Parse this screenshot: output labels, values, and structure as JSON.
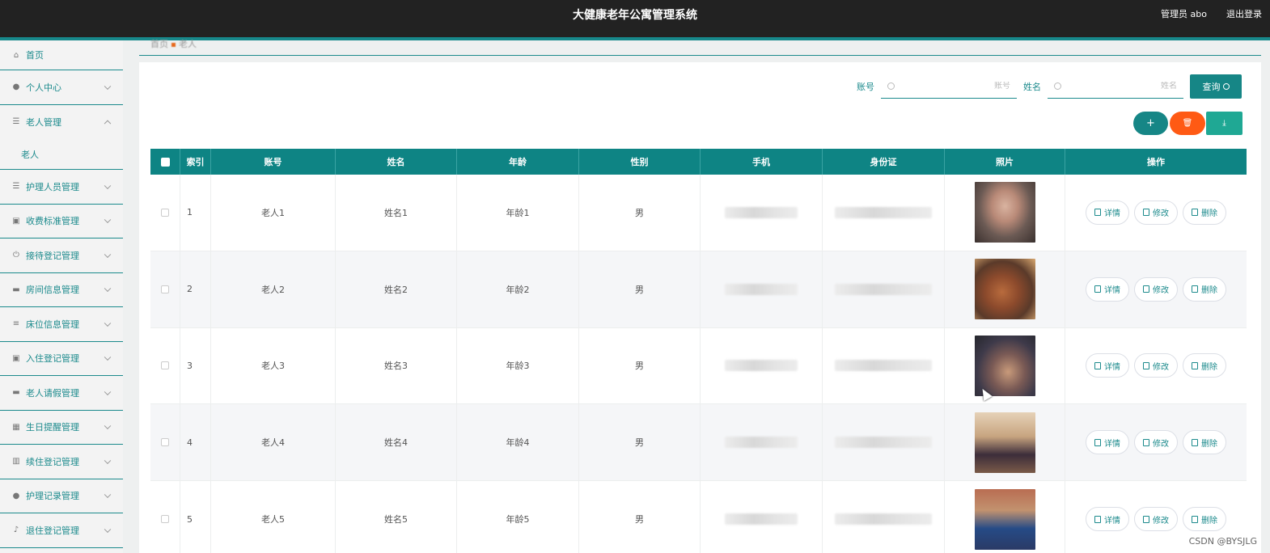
{
  "header": {
    "title": "大健康老年公寓管理系统",
    "user": "管理员 abo",
    "logout": "退出登录"
  },
  "sidebar": {
    "items": [
      {
        "label": "首页",
        "icon": "home-icon"
      },
      {
        "label": "个人中心",
        "icon": "user-icon"
      },
      {
        "label": "老人管理",
        "icon": "menu-icon",
        "expanded": true,
        "children": [
          "老人"
        ]
      },
      {
        "label": "护理人员管理",
        "icon": "menu-icon"
      },
      {
        "label": "收费标准管理",
        "icon": "clipboard-icon"
      },
      {
        "label": "接待登记管理",
        "icon": "power-icon"
      },
      {
        "label": "房间信息管理",
        "icon": "monitor-icon"
      },
      {
        "label": "床位信息管理",
        "icon": "sliders-icon"
      },
      {
        "label": "入住登记管理",
        "icon": "clipboard-icon"
      },
      {
        "label": "老人请假管理",
        "icon": "monitor-icon"
      },
      {
        "label": "生日提醒管理",
        "icon": "grid-icon"
      },
      {
        "label": "续住登记管理",
        "icon": "bar-chart-icon"
      },
      {
        "label": "护理记录管理",
        "icon": "user-icon"
      },
      {
        "label": "退住登记管理",
        "icon": "mic-icon"
      }
    ]
  },
  "breadcrumb": {
    "home": "首页",
    "current": "老人"
  },
  "search": {
    "account_label": "账号",
    "account_placeholder": "账号",
    "name_label": "姓名",
    "name_placeholder": "姓名",
    "query_button": "查询"
  },
  "actions": {
    "add": "+",
    "delete": "🗑",
    "export": "⤓"
  },
  "table": {
    "columns": [
      "索引",
      "账号",
      "姓名",
      "年龄",
      "性别",
      "手机",
      "身份证",
      "照片",
      "操作"
    ],
    "rows": [
      {
        "index": "1",
        "account": "老人1",
        "name": "姓名1",
        "age": "年龄1",
        "gender": "男"
      },
      {
        "index": "2",
        "account": "老人2",
        "name": "姓名2",
        "age": "年龄2",
        "gender": "男"
      },
      {
        "index": "3",
        "account": "老人3",
        "name": "姓名3",
        "age": "年龄3",
        "gender": "男"
      },
      {
        "index": "4",
        "account": "老人4",
        "name": "姓名4",
        "age": "年龄4",
        "gender": "男"
      },
      {
        "index": "5",
        "account": "老人5",
        "name": "姓名5",
        "age": "年龄5",
        "gender": "男"
      }
    ],
    "ops": {
      "detail": "详情",
      "edit": "修改",
      "delete": "删除"
    }
  },
  "watermark": "CSDN @BYSJLG",
  "colors": {
    "accent": "#17888a",
    "danger": "#ff5a14",
    "header_bg": "#222222"
  }
}
